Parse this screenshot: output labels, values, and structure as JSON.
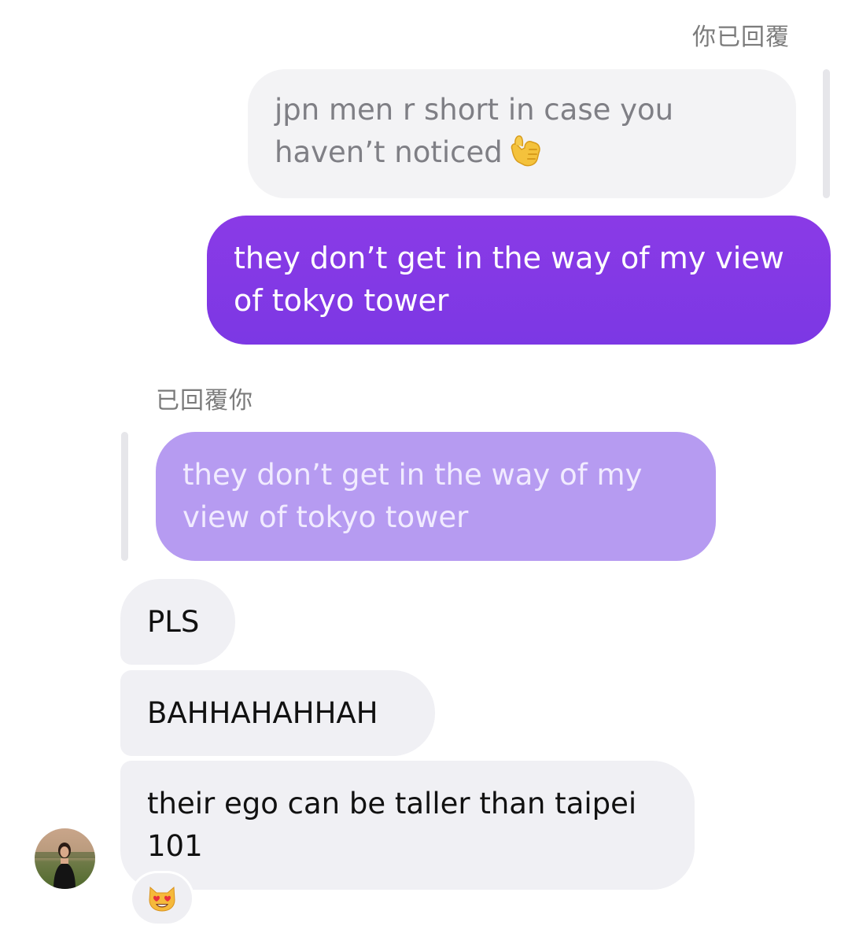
{
  "thread": {
    "you_replied_label": "你已回覆",
    "replied_to_you_label": "已回覆你",
    "quoted_outgoing": {
      "text": "jpn men r short in case you haven’t noticed",
      "emoji": "call-me-hand"
    },
    "sent_message": "they don’t get in the way of my view of tokyo tower",
    "quoted_incoming": "they don’t get in the way of my view of tokyo tower",
    "received_messages": [
      {
        "text": "PLS"
      },
      {
        "text": "BAHHAHAHHAH"
      },
      {
        "text": "their ego can be taller than taipei 101"
      }
    ],
    "reaction": "smiling-cat-heart-eyes",
    "colors": {
      "sent_bubble": "#8a3ae6",
      "quoted_incoming": "#b69bf1",
      "received_bubble": "#f0f0f4",
      "quoted_outgoing": "#f3f3f5"
    }
  }
}
